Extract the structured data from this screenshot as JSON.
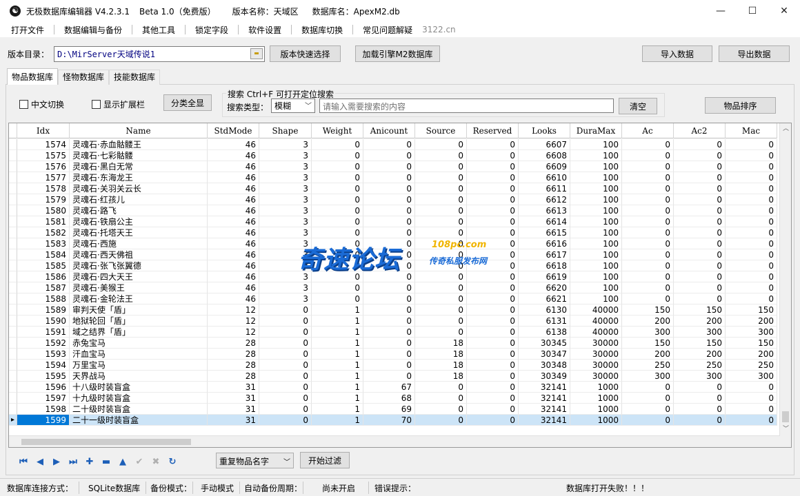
{
  "window": {
    "title_segments": [
      "无极数据库编辑器 V4.2.3.1",
      "Beta 1.0（免费版）",
      "版本名称：天域区",
      "数据库名：ApexM2.db"
    ],
    "controls": {
      "minimize": "—",
      "maximize": "☐",
      "close": "✕"
    }
  },
  "menu": {
    "items": [
      "打开文件",
      "数据编辑与备份",
      "其他工具",
      "锁定字段",
      "软件设置",
      "数据库切换",
      "常见问题解疑"
    ],
    "site": "3122.cn"
  },
  "version": {
    "label": "版本目录：",
    "path": "D:\\MirServer天域传说1",
    "quick_select": "版本快速选择",
    "load_engine": "加载引擎M2数据库",
    "import": "导入数据",
    "export": "导出数据"
  },
  "tabs": [
    "物品数据库",
    "怪物数据库",
    "技能数据库"
  ],
  "options": {
    "cn_switch": "中文切换",
    "show_ext": "显示扩展栏",
    "expand_all": "分类全显"
  },
  "search": {
    "title": "搜索  Ctrl+F 可打开定位搜索",
    "type_label": "搜索类型：",
    "type_value": "模糊",
    "placeholder": "请输入需要搜索的内容",
    "clear": "清空",
    "sort": "物品排序"
  },
  "grid": {
    "columns": [
      "Idx",
      "Name",
      "StdMode",
      "Shape",
      "Weight",
      "Anicount",
      "Source",
      "Reserved",
      "Looks",
      "DuraMax",
      "Ac",
      "Ac2",
      "Mac"
    ],
    "rows": [
      [
        "1574",
        "灵魂石·赤血骷髅王",
        "46",
        "3",
        "0",
        "0",
        "0",
        "0",
        "6607",
        "100",
        "0",
        "0",
        "0"
      ],
      [
        "1575",
        "灵魂石·七彩骷髅",
        "46",
        "3",
        "0",
        "0",
        "0",
        "0",
        "6608",
        "100",
        "0",
        "0",
        "0"
      ],
      [
        "1576",
        "灵魂石·黑白无常",
        "46",
        "3",
        "0",
        "0",
        "0",
        "0",
        "6609",
        "100",
        "0",
        "0",
        "0"
      ],
      [
        "1577",
        "灵魂石·东海龙王",
        "46",
        "3",
        "0",
        "0",
        "0",
        "0",
        "6610",
        "100",
        "0",
        "0",
        "0"
      ],
      [
        "1578",
        "灵魂石·关羽关云长",
        "46",
        "3",
        "0",
        "0",
        "0",
        "0",
        "6611",
        "100",
        "0",
        "0",
        "0"
      ],
      [
        "1579",
        "灵魂石·红孩儿",
        "46",
        "3",
        "0",
        "0",
        "0",
        "0",
        "6612",
        "100",
        "0",
        "0",
        "0"
      ],
      [
        "1580",
        "灵魂石·路飞",
        "46",
        "3",
        "0",
        "0",
        "0",
        "0",
        "6613",
        "100",
        "0",
        "0",
        "0"
      ],
      [
        "1581",
        "灵魂石·铁扇公主",
        "46",
        "3",
        "0",
        "0",
        "0",
        "0",
        "6614",
        "100",
        "0",
        "0",
        "0"
      ],
      [
        "1582",
        "灵魂石·托塔天王",
        "46",
        "3",
        "0",
        "0",
        "0",
        "0",
        "6615",
        "100",
        "0",
        "0",
        "0"
      ],
      [
        "1583",
        "灵魂石·西施",
        "46",
        "3",
        "0",
        "0",
        "0",
        "0",
        "6616",
        "100",
        "0",
        "0",
        "0"
      ],
      [
        "1584",
        "灵魂石·西天佛祖",
        "46",
        "3",
        "0",
        "0",
        "0",
        "0",
        "6617",
        "100",
        "0",
        "0",
        "0"
      ],
      [
        "1585",
        "灵魂石·张飞张翼德",
        "46",
        "3",
        "0",
        "0",
        "0",
        "0",
        "6618",
        "100",
        "0",
        "0",
        "0"
      ],
      [
        "1586",
        "灵魂石·四大天王",
        "46",
        "3",
        "0",
        "0",
        "0",
        "0",
        "6619",
        "100",
        "0",
        "0",
        "0"
      ],
      [
        "1587",
        "灵魂石·美猴王",
        "46",
        "3",
        "0",
        "0",
        "0",
        "0",
        "6620",
        "100",
        "0",
        "0",
        "0"
      ],
      [
        "1588",
        "灵魂石·金轮法王",
        "46",
        "3",
        "0",
        "0",
        "0",
        "0",
        "6621",
        "100",
        "0",
        "0",
        "0"
      ],
      [
        "1589",
        "审判天使「盾」",
        "12",
        "0",
        "1",
        "0",
        "0",
        "0",
        "6130",
        "40000",
        "150",
        "150",
        "150"
      ],
      [
        "1590",
        "地狱轮回「盾」",
        "12",
        "0",
        "1",
        "0",
        "0",
        "0",
        "6131",
        "40000",
        "200",
        "200",
        "200"
      ],
      [
        "1591",
        "域之结界「盾」",
        "12",
        "0",
        "1",
        "0",
        "0",
        "0",
        "6138",
        "40000",
        "300",
        "300",
        "300"
      ],
      [
        "1592",
        "赤兔宝马",
        "28",
        "0",
        "1",
        "0",
        "18",
        "0",
        "30345",
        "30000",
        "150",
        "150",
        "150"
      ],
      [
        "1593",
        "汗血宝马",
        "28",
        "0",
        "1",
        "0",
        "18",
        "0",
        "30347",
        "30000",
        "200",
        "200",
        "200"
      ],
      [
        "1594",
        "万里宝马",
        "28",
        "0",
        "1",
        "0",
        "18",
        "0",
        "30348",
        "30000",
        "250",
        "250",
        "250"
      ],
      [
        "1595",
        "天界战马",
        "28",
        "0",
        "1",
        "0",
        "18",
        "0",
        "30349",
        "30000",
        "300",
        "300",
        "300"
      ],
      [
        "1596",
        "十八级时装盲盒",
        "31",
        "0",
        "1",
        "67",
        "0",
        "0",
        "32141",
        "1000",
        "0",
        "0",
        "0"
      ],
      [
        "1597",
        "十九级时装盲盒",
        "31",
        "0",
        "1",
        "68",
        "0",
        "0",
        "32141",
        "1000",
        "0",
        "0",
        "0"
      ],
      [
        "1598",
        "二十级时装盲盒",
        "31",
        "0",
        "1",
        "69",
        "0",
        "0",
        "32141",
        "1000",
        "0",
        "0",
        "0"
      ],
      [
        "1599",
        "二十一级时装盲盒",
        "31",
        "0",
        "1",
        "70",
        "0",
        "0",
        "32141",
        "1000",
        "0",
        "0",
        "0"
      ]
    ],
    "selected_idx": "1599"
  },
  "watermark": {
    "main": "奇速论坛",
    "url": "108pc.com",
    "slogan": "传奇私服发布网"
  },
  "filter": {
    "combo": "重复物品名字",
    "start": "开始过滤"
  },
  "status": {
    "conn_label": "数据库连接方式：",
    "conn_value": "SQLite数据库",
    "backup_label": "备份模式：",
    "backup_value": "手动模式",
    "auto_label": "自动备份周期：",
    "auto_value": "尚未开启",
    "error_label": "错误提示：",
    "error_value": "数据库打开失败！！！"
  }
}
